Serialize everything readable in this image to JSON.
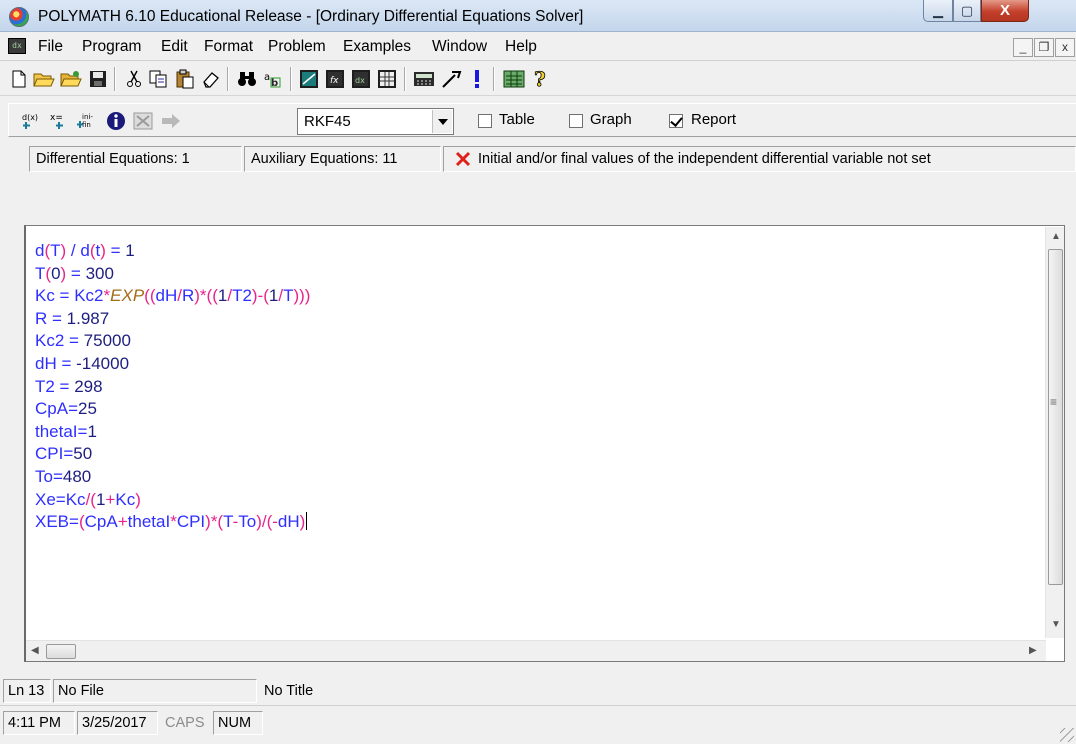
{
  "window": {
    "title": "POLYMATH 6.10 Educational Release - [Ordinary Differential Equations Solver]",
    "min_label": "—",
    "max_label": "▢",
    "close_label": "X"
  },
  "menu": {
    "items": [
      "File",
      "Program",
      "Edit",
      "Format",
      "Problem",
      "Examples",
      "Window",
      "Help"
    ],
    "mdi_buttons": [
      "_",
      "▫",
      "x"
    ]
  },
  "ode_toolbar": {
    "method": "RKF45",
    "options": [
      {
        "label": "Table",
        "checked": false
      },
      {
        "label": "Graph",
        "checked": false
      },
      {
        "label": "Report",
        "checked": true
      }
    ]
  },
  "info": {
    "differential": "Differential Equations: 1",
    "auxiliary": "Auxiliary Equations: 11",
    "message": "Initial and/or final values of the independent differential variable not set"
  },
  "editor": {
    "lines": [
      "d(T) / d(t) = 1",
      "T(0) = 300",
      "Kc = Kc2*EXP((dH/R)*((1/T2)-(1/T)))",
      "R = 1.987",
      "Kc2 = 75000",
      "dH = -14000",
      "T2 = 298",
      "CpA=25",
      "thetaI=1",
      "CPI=50",
      "To=480",
      "Xe=Kc/(1+Kc)",
      "XEB=(CpA+thetaI*CPI)*(T-To)/(-dH)"
    ]
  },
  "status": {
    "line": "Ln 13",
    "file": "No File",
    "title": "No Title",
    "time": "4:11 PM",
    "date": "3/25/2017",
    "caps": "CAPS",
    "num": "NUM"
  },
  "colors": {
    "variable": "#2f2fff",
    "operator": "#e8248b",
    "number": "#1e1e80",
    "function": "#a26c18",
    "error": "#e0201b"
  }
}
